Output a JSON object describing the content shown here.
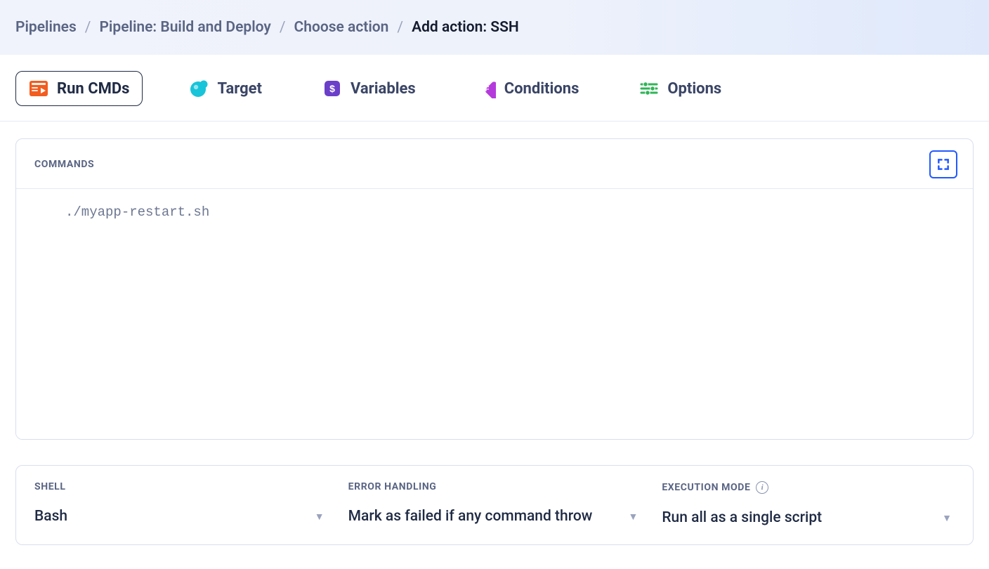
{
  "breadcrumb": {
    "items": [
      {
        "label": "Pipelines"
      },
      {
        "label": "Pipeline: Build and Deploy"
      },
      {
        "label": "Choose action"
      },
      {
        "label": "Add action: SSH"
      }
    ]
  },
  "tabs": [
    {
      "label": "Run CMDs",
      "icon": "run-cmds-icon"
    },
    {
      "label": "Target",
      "icon": "target-icon"
    },
    {
      "label": "Variables",
      "icon": "variables-icon"
    },
    {
      "label": "Conditions",
      "icon": "conditions-icon"
    },
    {
      "label": "Options",
      "icon": "options-icon"
    }
  ],
  "commands": {
    "title": "COMMANDS",
    "code": "./myapp-restart.sh"
  },
  "settings": {
    "shell": {
      "label": "SHELL",
      "value": "Bash"
    },
    "error": {
      "label": "ERROR HANDLING",
      "value": "Mark as failed if any command throw"
    },
    "execmode": {
      "label": "EXECUTION MODE",
      "value": "Run all as a single script"
    }
  }
}
